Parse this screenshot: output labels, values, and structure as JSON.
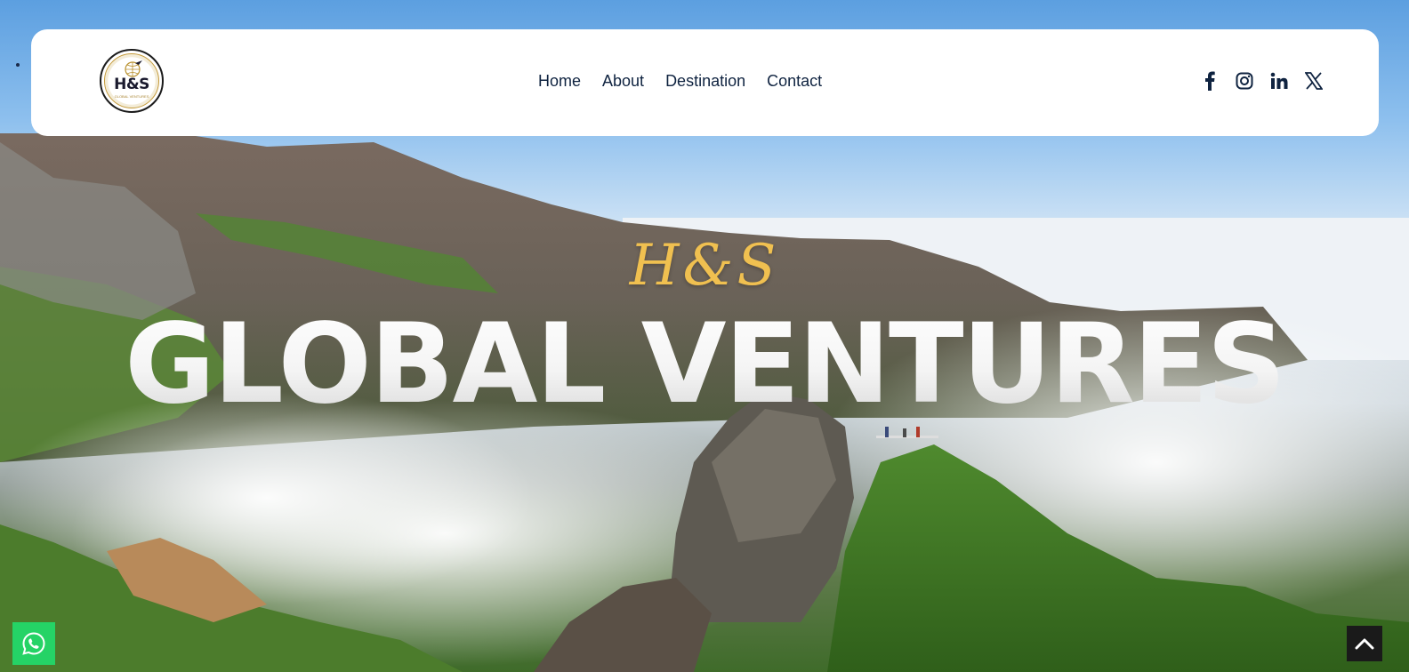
{
  "brand": {
    "logo_text": "H&S",
    "logo_sub": "GLOBAL VENTURES",
    "logo_alt": "H&S Global Ventures logo"
  },
  "nav": {
    "items": [
      {
        "label": "Home"
      },
      {
        "label": "About"
      },
      {
        "label": "Destination"
      },
      {
        "label": "Contact"
      }
    ]
  },
  "socials": [
    {
      "icon": "facebook-icon"
    },
    {
      "icon": "instagram-icon"
    },
    {
      "icon": "linkedin-icon"
    },
    {
      "icon": "x-twitter-icon"
    }
  ],
  "hero": {
    "script_title": "H&S",
    "title": "GLOBAL VENTURES"
  },
  "floating": {
    "whatsapp_icon": "whatsapp-icon",
    "back_to_top_icon": "chevron-up-icon"
  },
  "colors": {
    "nav_text": "#0f2340",
    "accent_gold": "#f0c050",
    "whatsapp_green": "#25d366",
    "top_button": "#1a1a1a"
  }
}
